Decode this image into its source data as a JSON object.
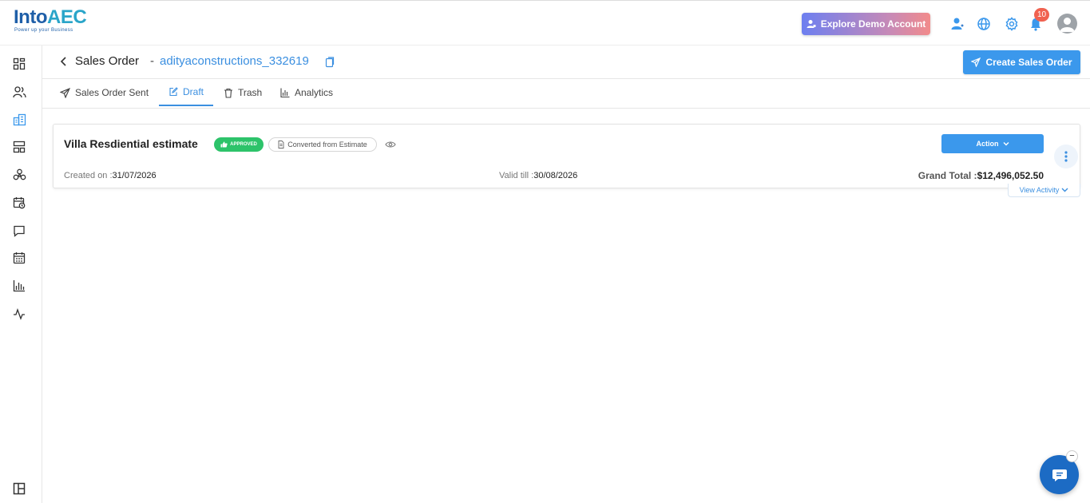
{
  "brand": {
    "logo_main": "Into",
    "logo_accent": "AEC",
    "tagline": "Power up your Business"
  },
  "topbar": {
    "demo_button": "Explore Demo Account",
    "notification_count": "10",
    "icons": [
      "add-user-icon",
      "globe-icon",
      "gear-icon",
      "bell-icon",
      "avatar"
    ]
  },
  "sidebar": {
    "items": [
      "dashboard-icon",
      "users-icon",
      "buildings-icon",
      "layout-icon",
      "cluster-icon",
      "calendar-clock-icon",
      "chat-icon",
      "calendar-icon",
      "bar-chart-icon",
      "activity-icon"
    ],
    "active": "buildings-icon",
    "bottom": "panel-layout-icon"
  },
  "header": {
    "title": "Sales Order",
    "separator": "-",
    "company": "adityaconstructions_332619",
    "create_button": "Create Sales Order"
  },
  "tabs": [
    {
      "label": "Sales Order Sent",
      "icon": "send-icon",
      "active": false
    },
    {
      "label": "Draft",
      "icon": "edit-icon",
      "active": true
    },
    {
      "label": "Trash",
      "icon": "trash-icon",
      "active": false
    },
    {
      "label": "Analytics",
      "icon": "bar-chart-icon",
      "active": false
    }
  ],
  "card": {
    "title": "Villa Resdiential estimate",
    "status_badge": "APPROVED",
    "source_badge": "Converted from Estimate",
    "action_button": "Action",
    "created_label": "Created on :",
    "created_value": "31/07/2026",
    "valid_label": "Valid till :",
    "valid_value": "30/08/2026",
    "grand_label": "Grand Total :",
    "grand_currency": "$",
    "grand_value": "12,496,052.50",
    "view_activity": "View Activity"
  },
  "chat": {
    "minimize_label": "−"
  },
  "colors": {
    "primary": "#3b98ec",
    "link": "#3b8fe0",
    "success": "#2dc36a",
    "badge": "#f06250",
    "chat": "#1c6bc4"
  }
}
